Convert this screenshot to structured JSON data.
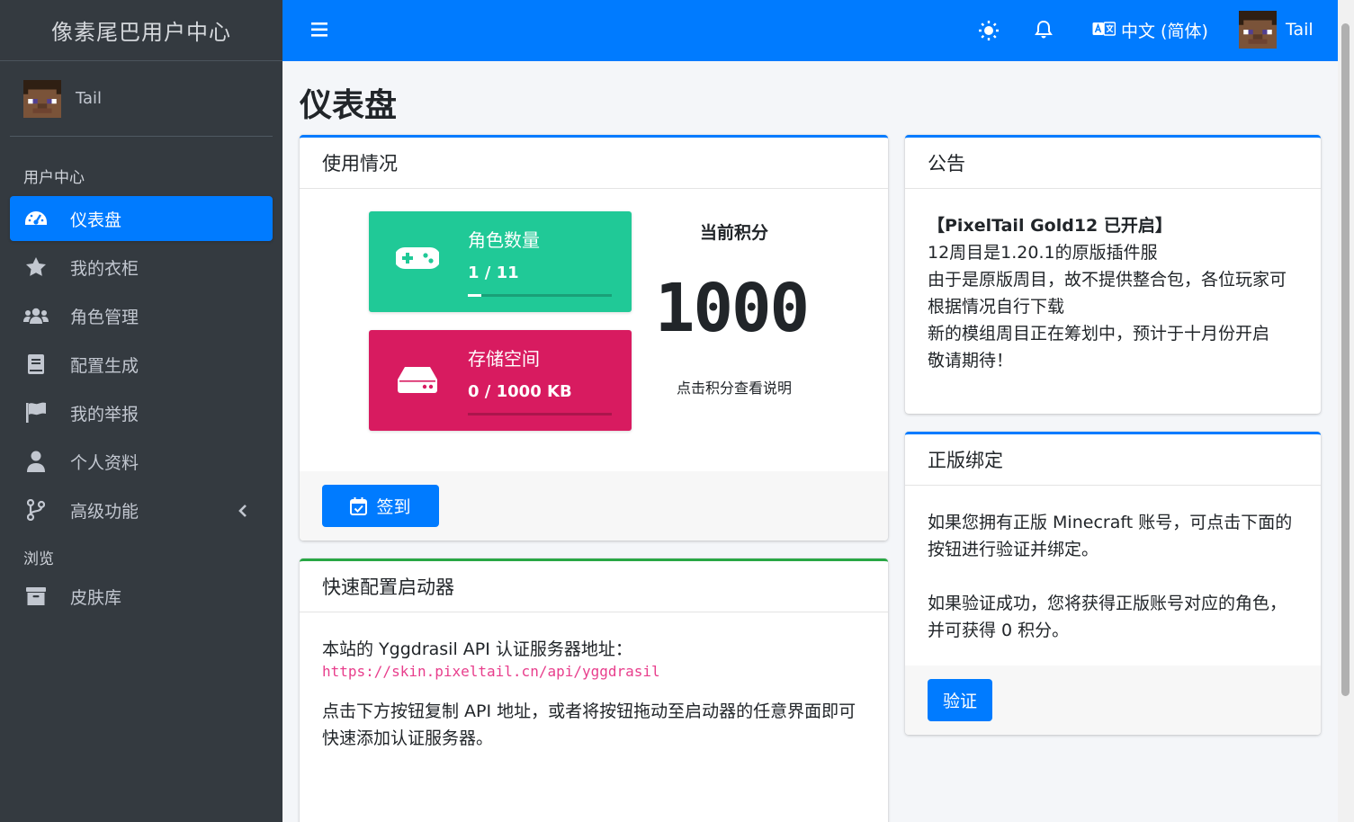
{
  "brand": "像素尾巴用户中心",
  "user": {
    "name": "Tail"
  },
  "sidebar": {
    "header_user": "用户中心",
    "items": [
      {
        "label": "仪表盘",
        "icon": "dashboard-icon"
      },
      {
        "label": "我的衣柜",
        "icon": "star-icon"
      },
      {
        "label": "角色管理",
        "icon": "users-icon"
      },
      {
        "label": "配置生成",
        "icon": "book-icon"
      },
      {
        "label": "我的举报",
        "icon": "flag-icon"
      },
      {
        "label": "个人资料",
        "icon": "user-icon"
      },
      {
        "label": "高级功能",
        "icon": "branch-icon"
      }
    ],
    "header_browse": "浏览",
    "browse_items": [
      {
        "label": "皮肤库",
        "icon": "archive-icon"
      }
    ]
  },
  "topbar": {
    "language": "中文 (简体)",
    "username": "Tail"
  },
  "page": {
    "title": "仪表盘"
  },
  "usage": {
    "title": "使用情况",
    "roles": {
      "label": "角色数量",
      "value": "1 / 11",
      "fraction": 0.0909
    },
    "storage": {
      "label": "存储空间",
      "value": "0 / 1000 KB",
      "fraction": 0
    },
    "score_label": "当前积分",
    "score": "1000",
    "score_hint": "点击积分查看说明",
    "checkin": "签到"
  },
  "quick": {
    "title": "快速配置启动器",
    "line1": "本站的 Yggdrasil API 认证服务器地址：",
    "url": "https://skin.pixeltail.cn/api/yggdrasil",
    "line2": "点击下方按钮复制 API 地址，或者将按钮拖动至启动器的任意界面即可快速添加认证服务器。"
  },
  "notice": {
    "title": "公告",
    "heading": "【PixelTail Gold12 已开启】",
    "lines": [
      "12周目是1.20.1的原版插件服",
      "由于是原版周目，故不提供整合包，各位玩家可根据情况自行下载",
      "新的模组周目正在筹划中，预计于十月份开启",
      "敬请期待！"
    ]
  },
  "bind": {
    "title": "正版绑定",
    "p1": "如果您拥有正版 Minecraft 账号，可点击下面的按钮进行验证并绑定。",
    "p2": "如果验证成功，您将获得正版账号对应的角色，并可获得 0 积分。",
    "verify": "验证"
  },
  "colors": {
    "primary": "#007bff",
    "sidebar": "#343a40",
    "success": "#20c997",
    "danger": "#d81b60",
    "link_code": "#e83e8c"
  }
}
